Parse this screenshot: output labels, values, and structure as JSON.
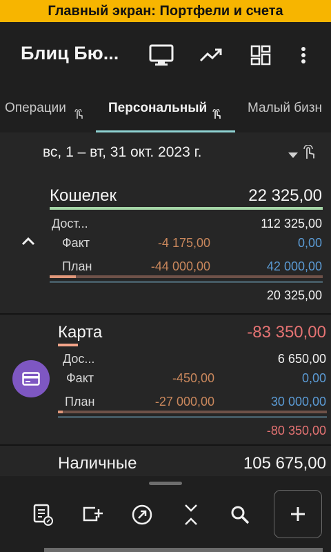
{
  "banner": {
    "text": "Главный экран: Портфели и счета"
  },
  "appbar": {
    "title": "Блиц Бю...",
    "icons": [
      "monitor-icon",
      "trending-up-icon",
      "dashboard-icon",
      "more-vert-icon"
    ]
  },
  "tabs": [
    {
      "label": "Операции",
      "active": false
    },
    {
      "label": "Персональный",
      "active": true
    },
    {
      "label": "Малый бизн",
      "active": false
    }
  ],
  "date_range": {
    "label": "вс, 1 – вт, 31 окт. 2023 г."
  },
  "accounts": [
    {
      "name": "Кошелек",
      "total": "22 325,00",
      "available_label": "Дост...",
      "available_value": "112 325,00",
      "fact_label": "Факт",
      "fact_expense": "-4 175,00",
      "fact_income": "0,00",
      "plan_label": "План",
      "plan_expense": "-44 000,00",
      "plan_income": "42 000,00",
      "remainder": "20 325,00",
      "colors": {
        "name_bar": "#a5d6a7"
      }
    },
    {
      "name": "Карта",
      "total": "-83 350,00",
      "available_label": "Дос...",
      "available_value": "6 650,00",
      "fact_label": "Факт",
      "fact_expense": "-450,00",
      "fact_income": "0,00",
      "plan_label": "План",
      "plan_expense": "-27 000,00",
      "plan_income": "30 000,00",
      "remainder": "-80 350,00",
      "icon": "credit-card-icon",
      "colors": {
        "name_bar": "#f4a58a",
        "avatar": "#7e57c2"
      }
    },
    {
      "name": "Наличные",
      "total": "105 675,00"
    }
  ],
  "bottom_bar": {
    "icons": [
      "report-icon",
      "add-box-icon",
      "transfer-icon",
      "collapse-icon",
      "search-icon",
      "add-icon"
    ]
  },
  "colors": {
    "accent_tab": "#8fd3d3",
    "negative": "#e57373",
    "expense": "#c9875c",
    "income": "#5b9bd5",
    "banner": "#f7b500"
  }
}
